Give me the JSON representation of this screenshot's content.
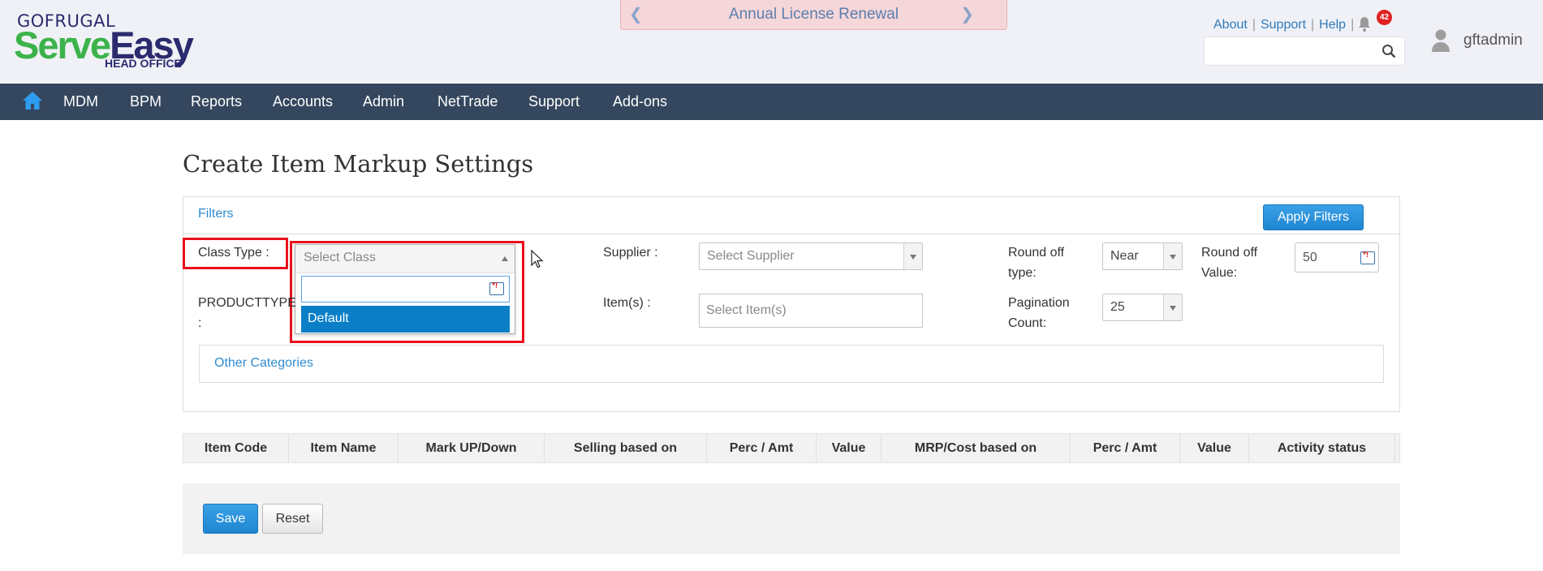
{
  "brand": {
    "top": "GOFRUGAL",
    "main_part1": "Serve",
    "main_part2": "Easy",
    "sub": "HEAD OFFICE"
  },
  "notice": {
    "text": "Annual License Renewal"
  },
  "top_links": {
    "about": "About",
    "support": "Support",
    "help": "Help"
  },
  "notifications": {
    "count": "42"
  },
  "user": {
    "name": "gftadmin"
  },
  "nav": {
    "items": [
      "MDM",
      "BPM",
      "Reports",
      "Accounts",
      "Admin",
      "NetTrade",
      "Support",
      "Add-ons"
    ]
  },
  "page": {
    "title": "Create Item Markup Settings"
  },
  "filters": {
    "link": "Filters",
    "apply": "Apply Filters",
    "class_type_label": "Class Type :",
    "class_placeholder": "Select Class",
    "class_options": [
      "Default"
    ],
    "producttype_label_1": "PRODUCTTYPE",
    "producttype_label_2": ":",
    "supplier_label": "Supplier :",
    "supplier_placeholder": "Select Supplier",
    "items_label": "Item(s) :",
    "items_placeholder": "Select Item(s)",
    "roundoff_type_label_1": "Round off",
    "roundoff_type_label_2": "type:",
    "roundoff_type_value": "Near",
    "roundoff_value_label_1": "Round off",
    "roundoff_value_label_2": "Value:",
    "roundoff_value": "50",
    "pagination_label_1": "Pagination",
    "pagination_label_2": "Count:",
    "pagination_value": "25",
    "other_categories": "Other Categories"
  },
  "table": {
    "columns": [
      "Item Code",
      "Item Name",
      "Mark UP/Down",
      "Selling based on",
      "Perc / Amt",
      "Value",
      "MRP/Cost based on",
      "Perc / Amt",
      "Value",
      "Activity status"
    ]
  },
  "actions": {
    "save": "Save",
    "reset": "Reset"
  },
  "colors": {
    "nav_bg": "#34475e",
    "primary": "#1f86d1",
    "highlight": "#e8101c",
    "selected_option": "#0a7fc8"
  }
}
